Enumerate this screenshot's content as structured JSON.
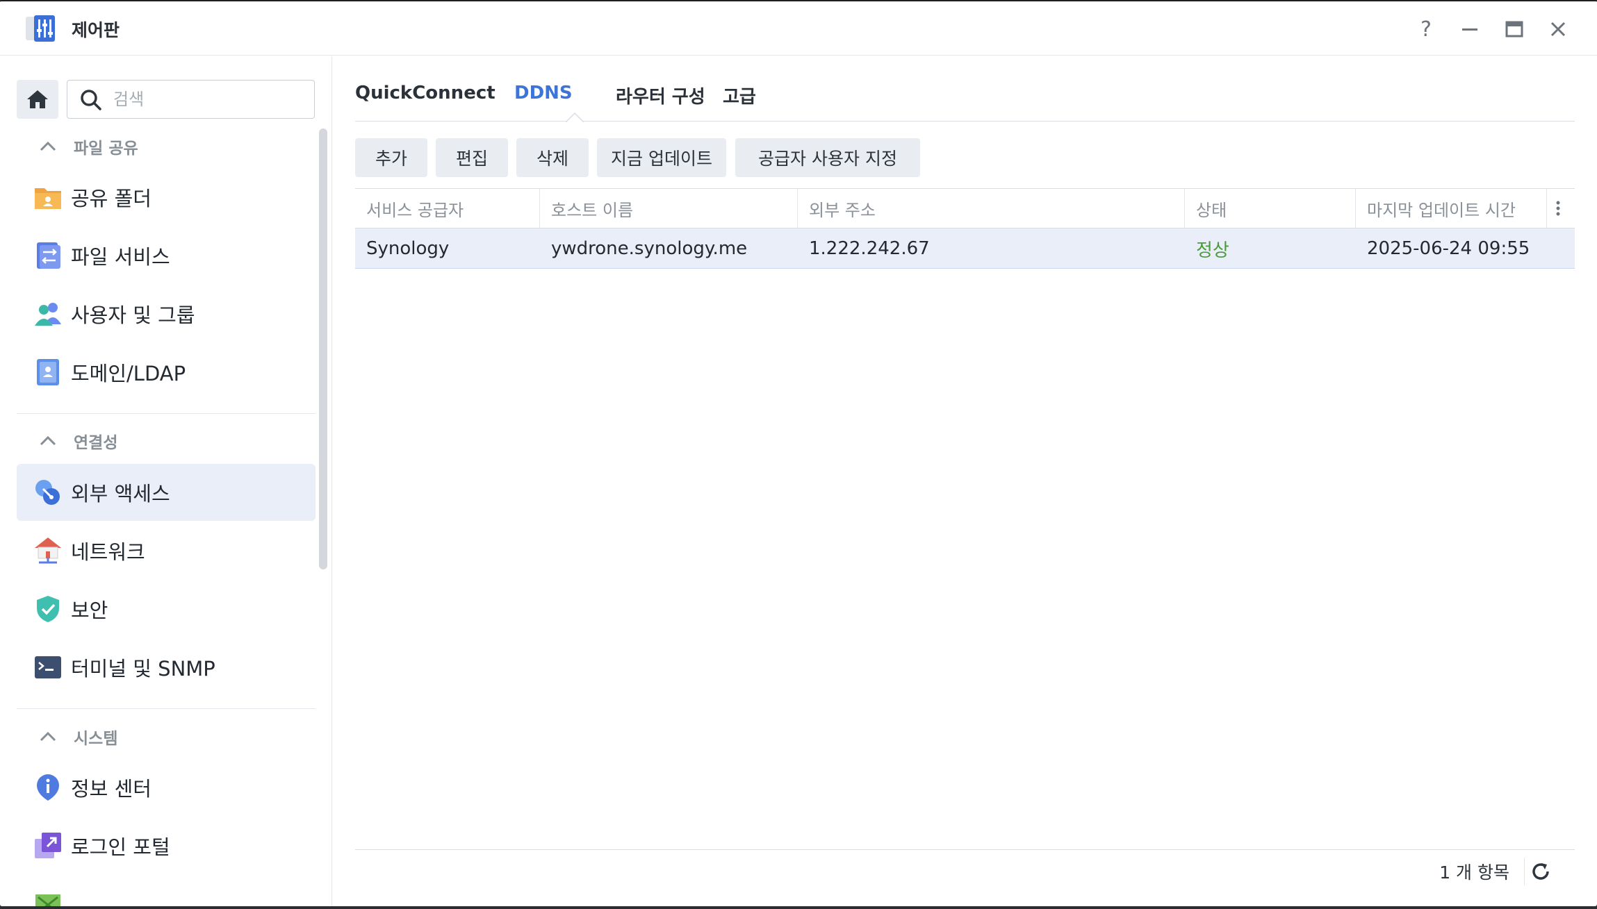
{
  "window": {
    "title": "제어판"
  },
  "title_controls": {
    "help": "?",
    "minimize": "—",
    "maximize": "▭",
    "close": "✕"
  },
  "sidebar": {
    "search_placeholder": "검색",
    "sections": [
      {
        "title": "파일 공유",
        "items": [
          {
            "label": "공유 폴더",
            "icon": "shared-folder-icon"
          },
          {
            "label": "파일 서비스",
            "icon": "file-services-icon"
          },
          {
            "label": "사용자 및 그룹",
            "icon": "users-groups-icon"
          },
          {
            "label": "도메인/LDAP",
            "icon": "domain-ldap-icon"
          }
        ]
      },
      {
        "title": "연결성",
        "items": [
          {
            "label": "외부 액세스",
            "icon": "external-access-icon",
            "active": true
          },
          {
            "label": "네트워크",
            "icon": "network-icon"
          },
          {
            "label": "보안",
            "icon": "security-shield-icon"
          },
          {
            "label": "터미널 및 SNMP",
            "icon": "terminal-icon"
          }
        ]
      },
      {
        "title": "시스템",
        "items": [
          {
            "label": "정보 센터",
            "icon": "info-center-icon"
          },
          {
            "label": "로그인 포털",
            "icon": "login-portal-icon"
          }
        ]
      }
    ]
  },
  "tabs": [
    {
      "label": "QuickConnect"
    },
    {
      "label": "DDNS",
      "active": true
    },
    {
      "label": "라우터 구성"
    },
    {
      "label": "고급"
    }
  ],
  "toolbar": {
    "add": "추가",
    "edit": "편집",
    "delete": "삭제",
    "update_now": "지금 업데이트",
    "customize_provider": "공급자 사용자 지정"
  },
  "table": {
    "columns": [
      "서비스 공급자",
      "호스트 이름",
      "외부 주소",
      "상태",
      "마지막 업데이트 시간"
    ],
    "rows": [
      [
        "Synology",
        "ywdrone.synology.me",
        "1.222.242.67",
        "정상",
        "2025-06-24 09:55"
      ]
    ]
  },
  "footer": {
    "count": "1 개 항목"
  },
  "colors": {
    "accent": "#3d74d9",
    "status_ok": "#4a9b3c",
    "selected_row": "#e9eef8"
  }
}
